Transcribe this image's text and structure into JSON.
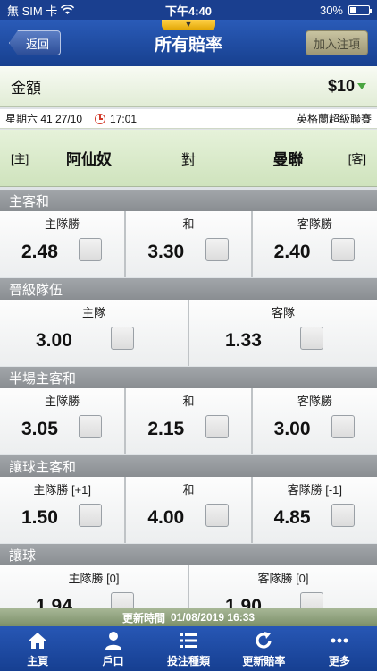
{
  "status_bar": {
    "carrier": "無 SIM 卡",
    "time": "下午4:40",
    "battery": "30%",
    "battery_level": 0.3
  },
  "nav": {
    "back_label": "返回",
    "title": "所有賠率",
    "add_bet_label": "加入注項"
  },
  "amount": {
    "label": "金額",
    "value": "$10"
  },
  "match": {
    "date": "星期六 41 27/10",
    "time": "17:01",
    "league": "英格蘭超級聯賽",
    "home_tag": "[主]",
    "home_team": "阿仙奴",
    "vs": "對",
    "away_team": "曼聯",
    "away_tag": "[客]"
  },
  "sections": [
    {
      "title": "主客和",
      "cells": [
        {
          "label": "主隊勝",
          "odds": "2.48"
        },
        {
          "label": "和",
          "odds": "3.30"
        },
        {
          "label": "客隊勝",
          "odds": "2.40"
        }
      ]
    },
    {
      "title": "晉級隊伍",
      "cells": [
        {
          "label": "主隊",
          "odds": "3.00"
        },
        {
          "label": "客隊",
          "odds": "1.33"
        }
      ]
    },
    {
      "title": "半場主客和",
      "cells": [
        {
          "label": "主隊勝",
          "odds": "3.05"
        },
        {
          "label": "和",
          "odds": "2.15"
        },
        {
          "label": "客隊勝",
          "odds": "3.00"
        }
      ]
    },
    {
      "title": "讓球主客和",
      "cells": [
        {
          "label": "主隊勝 [+1]",
          "odds": "1.50"
        },
        {
          "label": "和",
          "odds": "4.00"
        },
        {
          "label": "客隊勝 [-1]",
          "odds": "4.85"
        }
      ]
    },
    {
      "title": "讓球",
      "cells": [
        {
          "label": "主隊勝 [0]",
          "odds": "1.94"
        },
        {
          "label": "客隊勝 [0]",
          "odds": "1.90"
        }
      ]
    }
  ],
  "update": {
    "label": "更新時間",
    "value": "01/08/2019 16:33"
  },
  "tabs": [
    {
      "label": "主頁",
      "icon": "home-icon"
    },
    {
      "label": "戶口",
      "icon": "person-icon"
    },
    {
      "label": "投注種類",
      "icon": "list-icon"
    },
    {
      "label": "更新賠率",
      "icon": "refresh-icon"
    },
    {
      "label": "更多",
      "icon": "more-icon"
    }
  ]
}
